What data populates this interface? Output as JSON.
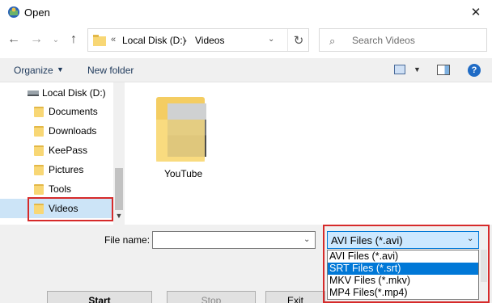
{
  "window": {
    "title": "Open",
    "close_glyph": "✕"
  },
  "nav": {
    "back": "←",
    "forward": "→",
    "recent": "⌄",
    "up": "↑",
    "address": {
      "chevrons": "«",
      "segments": [
        "Local Disk (D:)",
        "Videos"
      ],
      "separator": "›",
      "dropdown": "⌄",
      "refresh": "↻"
    },
    "search_placeholder": "Search Videos",
    "search_icon": "search-icon"
  },
  "toolbar": {
    "organize": "Organize",
    "new_folder": "New folder",
    "help": "?"
  },
  "sidebar": {
    "drive": "Local Disk (D:)",
    "items": [
      {
        "label": "Documents"
      },
      {
        "label": "Downloads"
      },
      {
        "label": "KeePass"
      },
      {
        "label": "Pictures"
      },
      {
        "label": "Tools"
      },
      {
        "label": "Videos",
        "selected": true
      }
    ]
  },
  "files": [
    {
      "name": "YouTube",
      "type": "folder"
    }
  ],
  "bottom": {
    "file_name_label": "File name:",
    "file_name_value": "",
    "file_type_selected": "AVI Files (*.avi)",
    "file_type_options": [
      "AVI Files (*.avi)",
      "SRT Files (*.srt)",
      "MKV Files (*.mkv)",
      "MP4 Files(*.mp4)"
    ],
    "hovered_option_index": 1,
    "buttons": {
      "start": "Start",
      "stop": "Stop",
      "exit": "Exit"
    }
  },
  "colors": {
    "selection": "#0078d7",
    "highlight_border": "#d62a2a",
    "nav_selected": "#cce4f7"
  }
}
